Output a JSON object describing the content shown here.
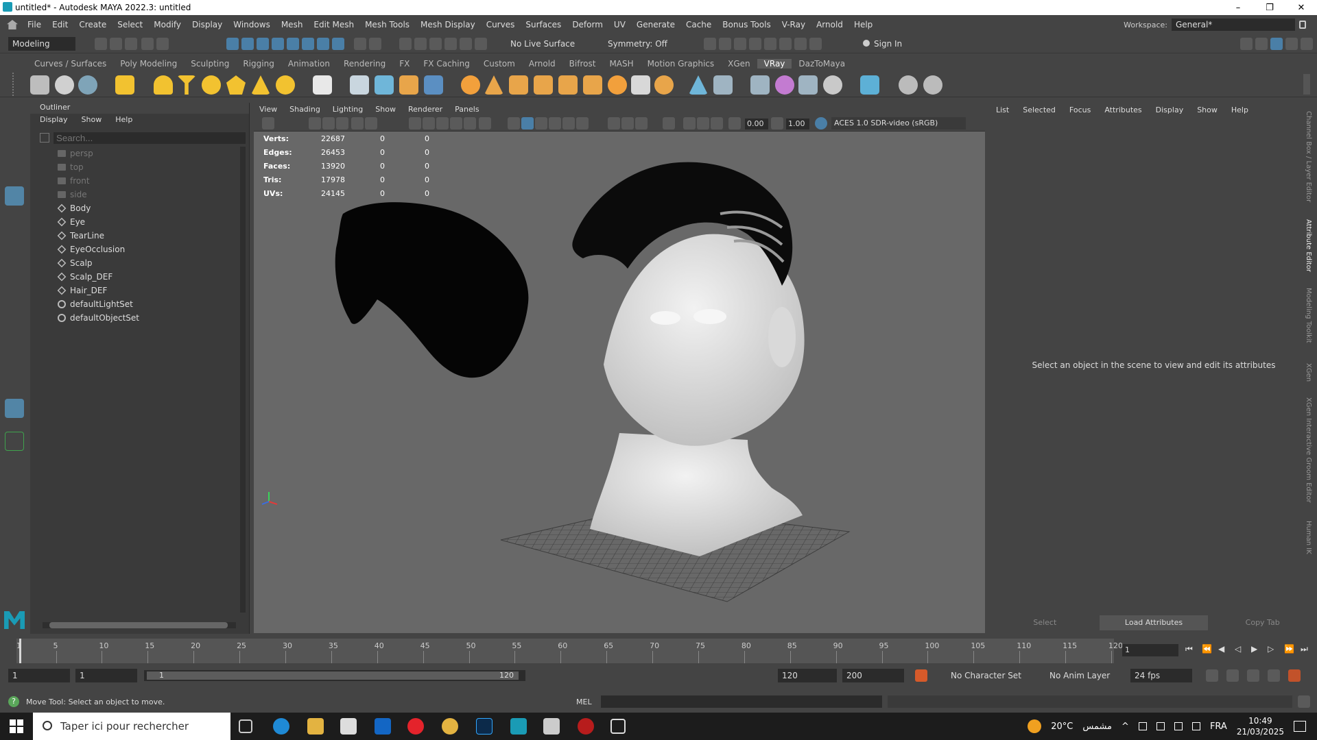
{
  "window": {
    "title": "untitled* - Autodesk MAYA 2022.3: untitled",
    "min": "–",
    "max": "❐",
    "close": "✕"
  },
  "menubar": {
    "items": [
      "File",
      "Edit",
      "Create",
      "Select",
      "Modify",
      "Display",
      "Windows",
      "Mesh",
      "Edit Mesh",
      "Mesh Tools",
      "Mesh Display",
      "Curves",
      "Surfaces",
      "Deform",
      "UV",
      "Generate",
      "Cache",
      "Bonus Tools",
      "V-Ray",
      "Arnold",
      "Help"
    ],
    "workspace_label": "Workspace:",
    "workspace_value": "General*"
  },
  "statusline": {
    "mode": "Modeling",
    "live_surface": "No Live Surface",
    "symmetry": "Symmetry: Off",
    "sign_in": "Sign In"
  },
  "shelf": {
    "tabs": [
      "Curves / Surfaces",
      "Poly Modeling",
      "Sculpting",
      "Rigging",
      "Animation",
      "Rendering",
      "FX",
      "FX Caching",
      "Custom",
      "Arnold",
      "Bifrost",
      "MASH",
      "Motion Graphics",
      "XGen",
      "VRay",
      "DazToMaya"
    ],
    "active": "VRay"
  },
  "outliner": {
    "title": "Outliner",
    "menu": [
      "Display",
      "Show",
      "Help"
    ],
    "search_placeholder": "Search...",
    "items": [
      {
        "label": "persp",
        "kind": "camera"
      },
      {
        "label": "top",
        "kind": "camera"
      },
      {
        "label": "front",
        "kind": "camera"
      },
      {
        "label": "side",
        "kind": "camera"
      },
      {
        "label": "Body",
        "kind": "mesh"
      },
      {
        "label": "Eye",
        "kind": "mesh"
      },
      {
        "label": "TearLine",
        "kind": "mesh"
      },
      {
        "label": "EyeOcclusion",
        "kind": "mesh"
      },
      {
        "label": "Scalp",
        "kind": "mesh"
      },
      {
        "label": "Scalp_DEF",
        "kind": "mesh"
      },
      {
        "label": "Hair_DEF",
        "kind": "mesh"
      },
      {
        "label": "defaultLightSet",
        "kind": "set"
      },
      {
        "label": "defaultObjectSet",
        "kind": "set"
      }
    ]
  },
  "viewport": {
    "menu": [
      "View",
      "Shading",
      "Lighting",
      "Show",
      "Renderer",
      "Panels"
    ],
    "exposure": "0.00",
    "gamma": "1.00",
    "color_space": "ACES 1.0 SDR-video (sRGB)",
    "hud": [
      {
        "label": "Verts:",
        "a": "22687",
        "b": "0",
        "c": "0"
      },
      {
        "label": "Edges:",
        "a": "26453",
        "b": "0",
        "c": "0"
      },
      {
        "label": "Faces:",
        "a": "13920",
        "b": "0",
        "c": "0"
      },
      {
        "label": "Tris:",
        "a": "17978",
        "b": "0",
        "c": "0"
      },
      {
        "label": "UVs:",
        "a": "24145",
        "b": "0",
        "c": "0"
      }
    ]
  },
  "attribute_editor": {
    "menu": [
      "List",
      "Selected",
      "Focus",
      "Attributes",
      "Display",
      "Show",
      "Help"
    ],
    "message": "Select an object in the scene to view and edit its attributes",
    "select": "Select",
    "load": "Load Attributes",
    "copy": "Copy Tab"
  },
  "side_tabs": [
    "Channel Box / Layer Editor",
    "Attribute Editor",
    "Modeling Toolkit",
    "XGen",
    "XGen Interactive Groom Editor",
    "Human IK"
  ],
  "timeline": {
    "ticks": [
      "1",
      "5",
      "10",
      "15",
      "20",
      "25",
      "30",
      "35",
      "40",
      "45",
      "50",
      "55",
      "60",
      "65",
      "70",
      "75",
      "80",
      "85",
      "90",
      "95",
      "100",
      "105",
      "110",
      "115",
      "120"
    ],
    "current_frame": "1"
  },
  "range": {
    "start": "1",
    "playback_start": "1",
    "slider_start": "1",
    "slider_end": "120",
    "playback_end": "120",
    "end": "200",
    "character_set": "No Character Set",
    "anim_layer": "No Anim Layer",
    "fps": "24 fps"
  },
  "helpline": {
    "text": "Move Tool: Select an object to move.",
    "mel": "MEL"
  },
  "taskbar": {
    "search": "Taper ici pour rechercher",
    "weather": "20°C",
    "weather_label": "مشمس",
    "lang": "FRA",
    "time": "10:49",
    "date": "21/03/2025"
  }
}
